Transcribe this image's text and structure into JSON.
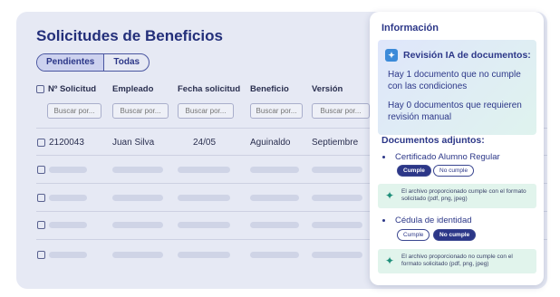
{
  "page": {
    "title": "Solicitudes de Beneficios",
    "tabs": [
      {
        "label": "Pendientes",
        "active": true
      },
      {
        "label": "Todas",
        "active": false
      }
    ]
  },
  "table": {
    "columns": [
      "Nº Solicitud",
      "Empleado",
      "Fecha solicitud",
      "Beneficio",
      "Versión"
    ],
    "filter_placeholder": "Buscar por...",
    "rows": [
      {
        "id": "2120043",
        "employee": "Juan Silva",
        "date": "24/05",
        "benefit": "Aguinaldo",
        "version": "Septiembre"
      }
    ],
    "placeholder_rows": 4
  },
  "panel": {
    "title": "Información",
    "ai": {
      "heading": "Revisión IA de documentos:",
      "lines": [
        "Hay 1 documento que no cumple con las condiciones",
        "Hay 0 documentos que requieren revisión manual"
      ]
    },
    "docs_title": "Documentos adjuntos:",
    "documents": [
      {
        "name": "Certificado Alumno Regular",
        "cumple_label": "Cumple",
        "no_cumple_label": "No cumple",
        "status": "cumple",
        "note": "El archivo proporcionado cumple con el formato solicitado (pdf, png, jpeg)"
      },
      {
        "name": "Cédula de identidad",
        "cumple_label": "Cumple",
        "no_cumple_label": "No cumple",
        "status": "no_cumple",
        "note": "El archivo proporcionado no cumple con el formato solicitado (pdf, png, jpeg)"
      }
    ]
  },
  "colors": {
    "primary": "#2c3788",
    "card_bg": "#e6e9f4",
    "ai_icon": "#3b8ad9",
    "note_bg": "#e1f4ec"
  },
  "icons": [
    "checkbox-icon",
    "sparkle-ai-icon",
    "sparkle-icon"
  ]
}
